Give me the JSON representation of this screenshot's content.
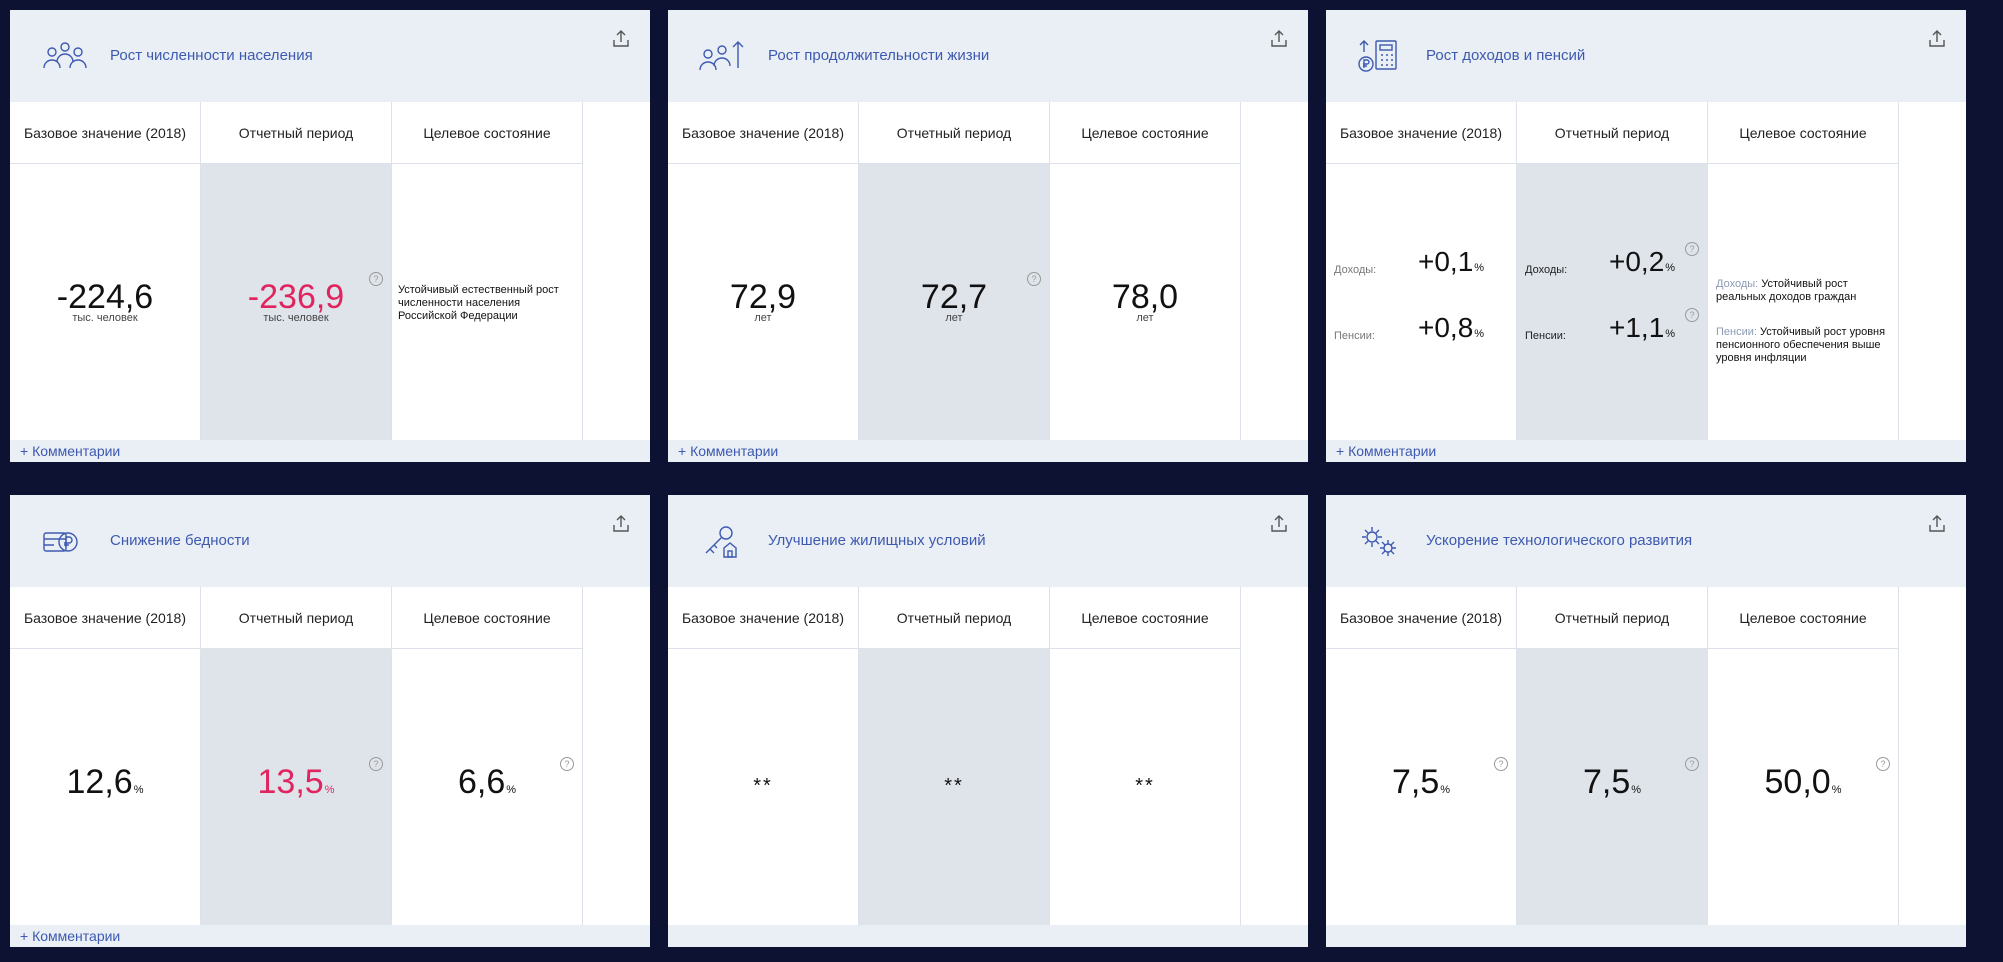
{
  "columns": {
    "base": "Базовое значение (2018)",
    "period": "Отчетный период",
    "target": "Целевое состояние"
  },
  "comments_label": "+ Комментарии",
  "help_glyph": "?",
  "cards": [
    {
      "title": "Рост численности населения",
      "icon": "people-icon",
      "base": {
        "value": "-224,6",
        "unit": "тыс. человек"
      },
      "period": {
        "value": "-236,9",
        "unit": "тыс. человек",
        "color": "#e0245e"
      },
      "target": {
        "text": "Устойчивый естественный рост численности населения Российской Федерации"
      }
    },
    {
      "title": "Рост продолжительности жизни",
      "icon": "people-arrow-up-icon",
      "base": {
        "value": "72,9",
        "unit": "лет"
      },
      "period": {
        "value": "72,7",
        "unit": "лет"
      },
      "target": {
        "value": "78,0",
        "unit": "лет"
      }
    },
    {
      "title": "Рост доходов и пенсий",
      "icon": "income-calculator-icon",
      "income_label": "Доходы:",
      "pension_label": "Пенсии:",
      "base": {
        "income": "+0,1",
        "pension": "+0,8",
        "unit": "%"
      },
      "period": {
        "income": "+0,2",
        "pension": "+1,1",
        "unit": "%"
      },
      "target": {
        "income_text": "Устойчивый рост реальных доходов граждан",
        "pension_text": "Устойчивый рост уровня пенсионного обеспечения выше уровня инфляции"
      }
    },
    {
      "title": "Снижение бедности",
      "icon": "wallet-ruble-icon",
      "base": {
        "value": "12,6",
        "unit": "%"
      },
      "period": {
        "value": "13,5",
        "unit": "%",
        "color": "#e0245e"
      },
      "target": {
        "value": "6,6",
        "unit": "%"
      }
    },
    {
      "title": "Улучшение жилищных условий",
      "icon": "house-key-icon",
      "base": {
        "value": "**"
      },
      "period": {
        "value": "**"
      },
      "target": {
        "value": "**"
      }
    },
    {
      "title": "Ускорение технологического развития",
      "icon": "gears-icon",
      "base": {
        "value": "7,5",
        "unit": "%"
      },
      "period": {
        "value": "7,5",
        "unit": "%"
      },
      "target": {
        "value": "50,0",
        "unit": "%"
      }
    }
  ],
  "colors": {
    "accent": "#3d5ab0",
    "negative": "#e0245e",
    "header_bg": "#eaeef5",
    "period_bg": "#dfe4eb",
    "page_bg": "#0d1233"
  }
}
